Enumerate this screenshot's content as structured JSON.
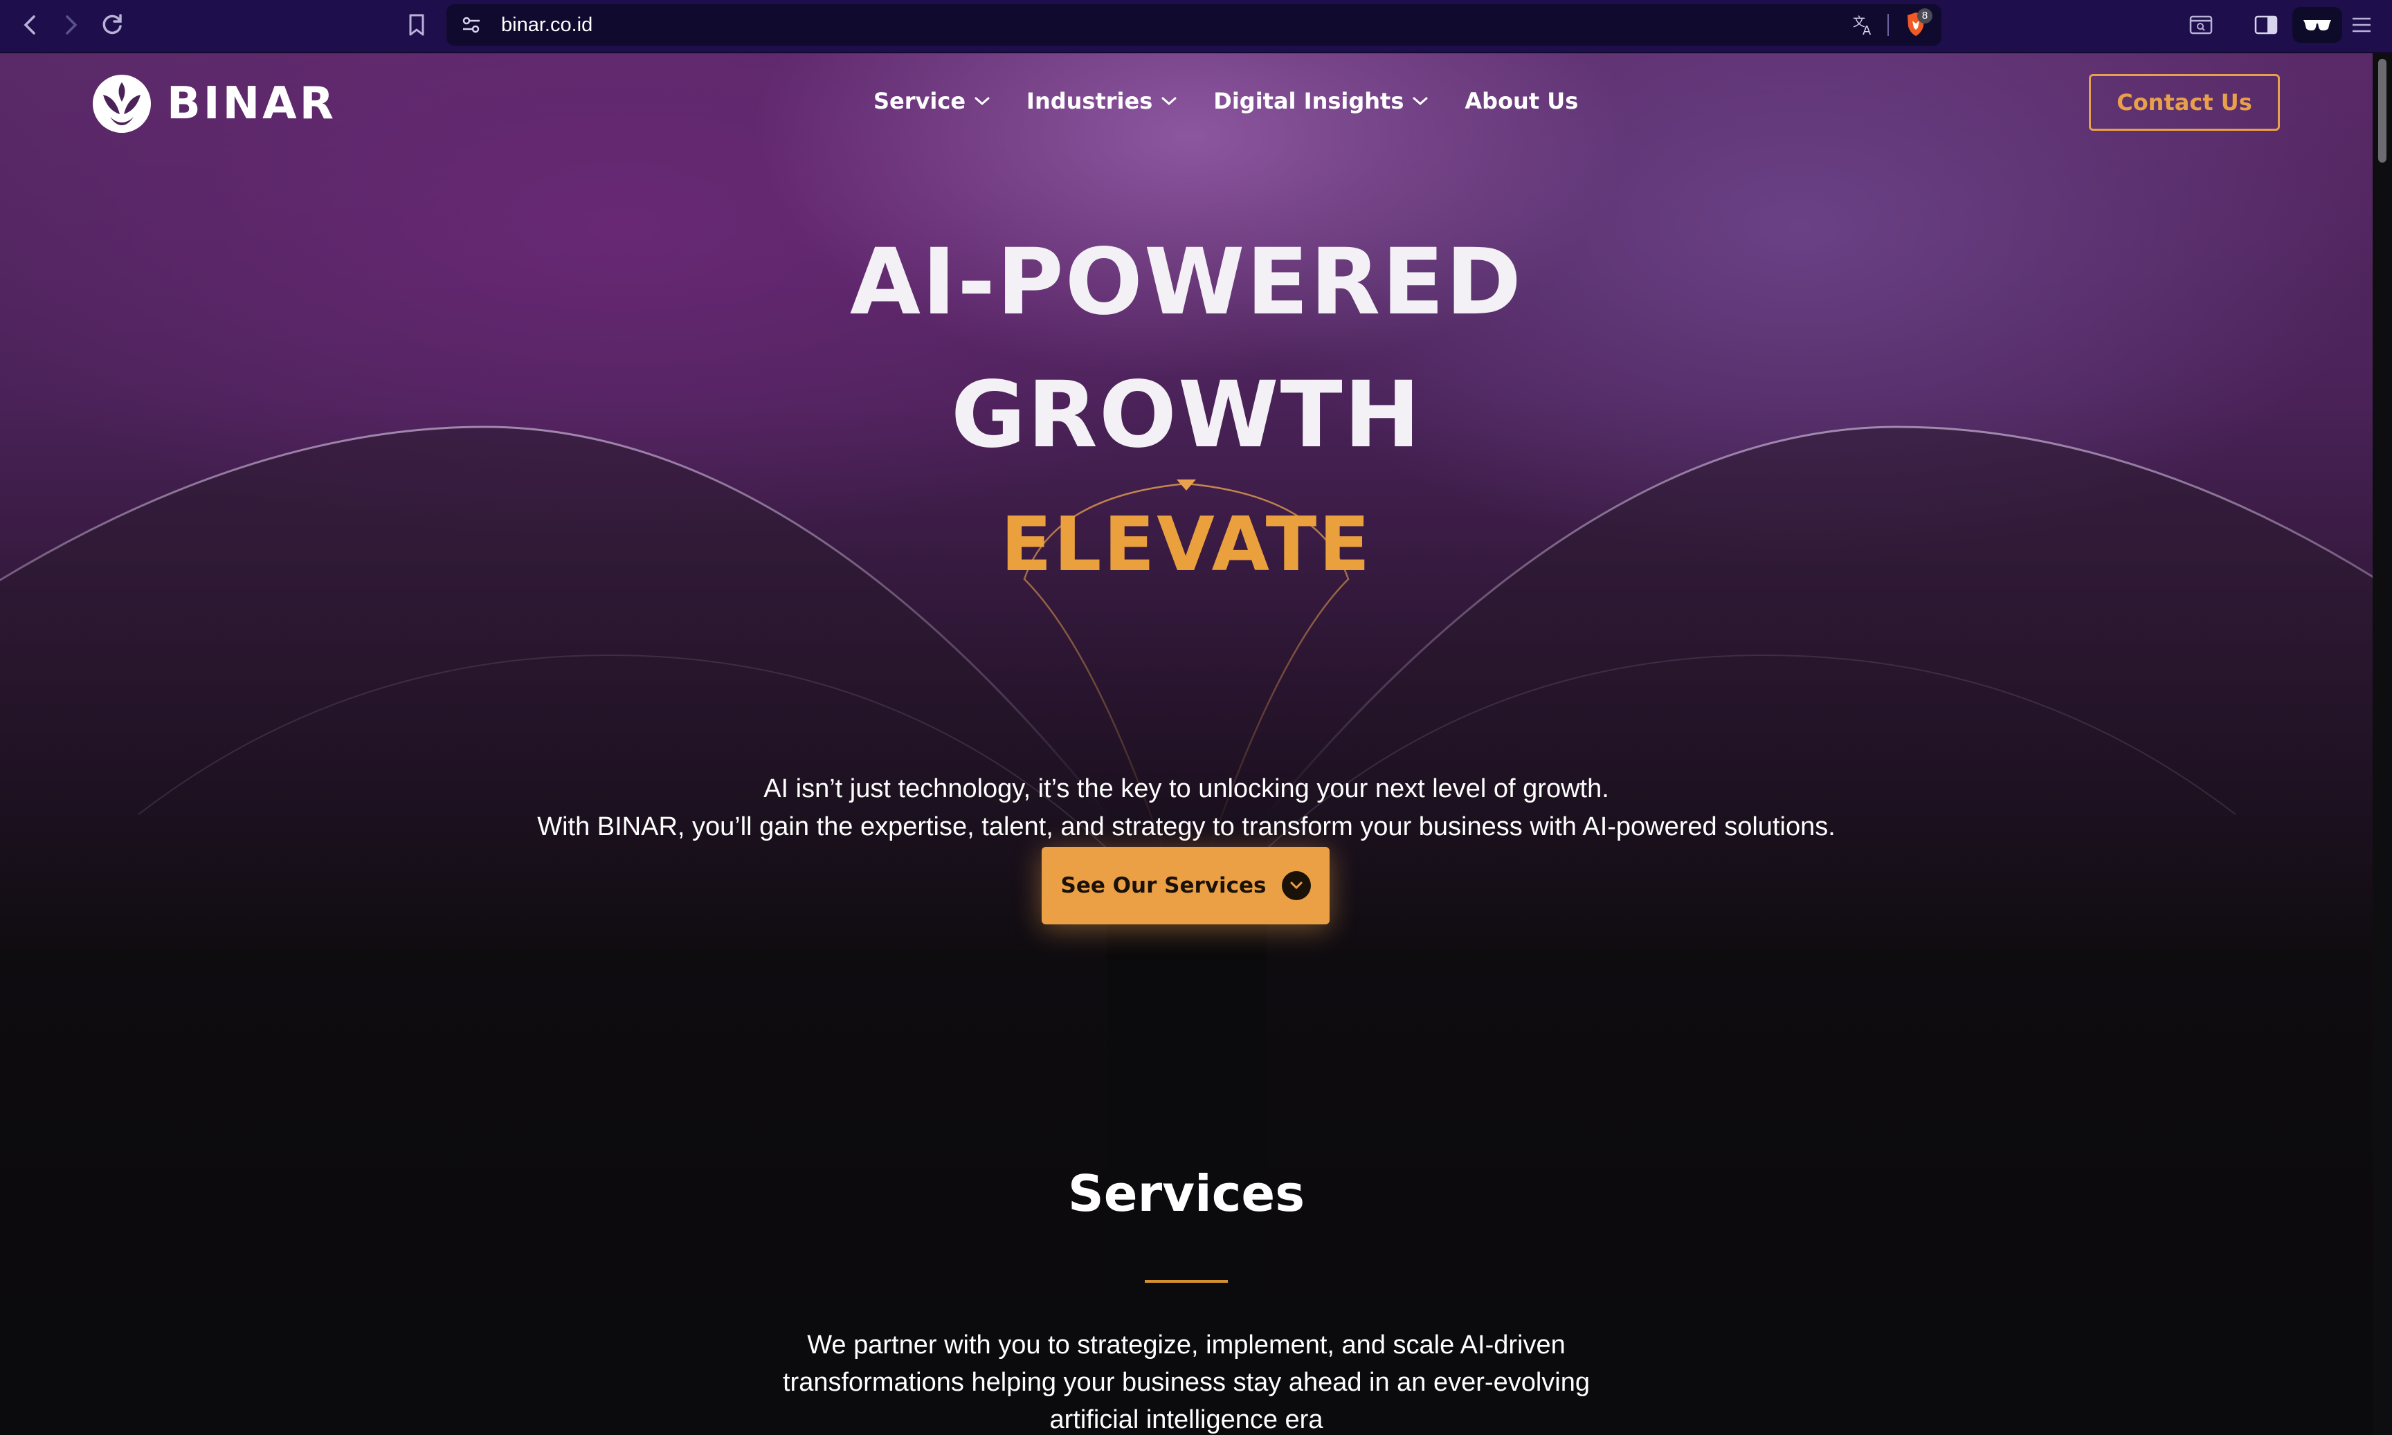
{
  "browser": {
    "url": "binar.co.id",
    "shield_count": "8"
  },
  "header": {
    "logo_text": "BINAR",
    "nav": [
      {
        "label": "Service",
        "has_dropdown": true
      },
      {
        "label": "Industries",
        "has_dropdown": true
      },
      {
        "label": "Digital Insights",
        "has_dropdown": true
      },
      {
        "label": "About Us",
        "has_dropdown": false
      }
    ],
    "contact_label": "Contact Us"
  },
  "hero": {
    "line1": "AI-POWERED",
    "line2": "GROWTH",
    "accent": "ELEVATE",
    "sub1": "AI isn’t just technology, it’s the key to unlocking your next level of growth.",
    "sub2": "With BINAR, you’ll gain the expertise, talent, and strategy to transform your business with AI-powered solutions.",
    "cta_label": "See Our Services"
  },
  "services": {
    "title": "Services",
    "description": "We partner with you to strategize, implement, and scale AI-driven transformations helping your business stay ahead in an ever-evolving artificial intelligence era"
  },
  "colors": {
    "accent": "#eba046",
    "chrome_bg": "#1e0f4c",
    "page_bg": "#0b0a0c"
  }
}
